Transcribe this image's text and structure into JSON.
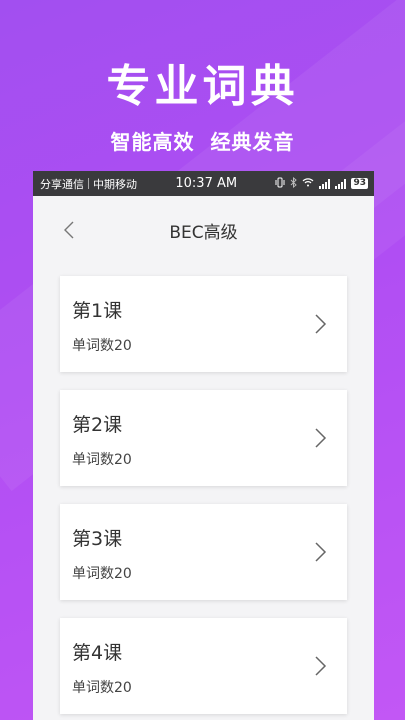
{
  "hero": {
    "title": "专业词典",
    "subtitle": "智能高效  经典发音"
  },
  "status_bar": {
    "carrier1": "分享通信",
    "carrier2": "中期移动",
    "time": "10:37 AM",
    "battery": "93"
  },
  "header": {
    "title": "BEC高级"
  },
  "lessons": [
    {
      "title": "第1课",
      "count_label": "单词数20"
    },
    {
      "title": "第2课",
      "count_label": "单词数20"
    },
    {
      "title": "第3课",
      "count_label": "单词数20"
    },
    {
      "title": "第4课",
      "count_label": "单词数20"
    }
  ],
  "colors": {
    "background_gradient_start": "#a24ff0",
    "background_gradient_end": "#c257f5",
    "status_bar": "#3a3a3d",
    "card": "#ffffff"
  }
}
